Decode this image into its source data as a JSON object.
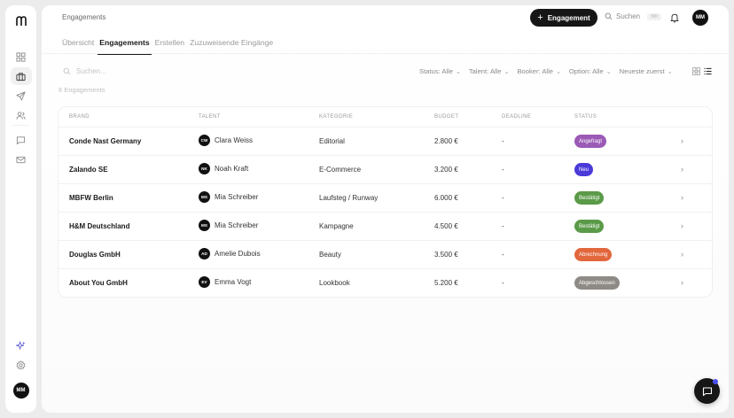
{
  "sidebar": {
    "logo": "logo-mark",
    "user_initials": "MM",
    "items": [
      {
        "icon": "grid-icon",
        "active": false
      },
      {
        "icon": "briefcase-icon",
        "active": true
      },
      {
        "icon": "send-icon",
        "active": false
      },
      {
        "icon": "users-icon",
        "active": false
      },
      {
        "icon": "chat-icon",
        "active": false
      },
      {
        "icon": "mail-icon",
        "active": false
      }
    ],
    "bottom_items": [
      {
        "icon": "sparkle-icon"
      },
      {
        "icon": "gear-icon"
      }
    ]
  },
  "header": {
    "breadcrumb": "Engagements",
    "new_button": "Engagement",
    "search_label": "Suchen",
    "search_shortcut": "⌘K",
    "user_initials": "MM"
  },
  "tabs": [
    {
      "label": "Übersicht",
      "active": false
    },
    {
      "label": "Engagements",
      "active": true
    },
    {
      "label": "Erstellen",
      "active": false
    },
    {
      "label": "Zuzuweisende Eingänge",
      "active": false
    }
  ],
  "toolbar": {
    "search_placeholder": "Suchen...",
    "filters": [
      {
        "label": "Status: Alle"
      },
      {
        "label": "Talent: Alle"
      },
      {
        "label": "Booker: Alle"
      },
      {
        "label": "Option: Alle"
      },
      {
        "label": "Neueste zuerst"
      }
    ],
    "view_modes": [
      "grid-view-icon",
      "list-view-icon"
    ],
    "active_view": "list"
  },
  "count_label": "6 Engagements",
  "table": {
    "columns": [
      "BRAND",
      "TALENT",
      "KATEGORIE",
      "BUDGET",
      "DEADLINE",
      "STATUS"
    ],
    "rows": [
      {
        "brand": "Conde Nast Germany",
        "initials": "CW",
        "talent": "Clara Weiss",
        "category": "Editorial",
        "budget": "2.800 €",
        "deadline": "-",
        "status": "Angefragt",
        "status_color": "#9b5ab5"
      },
      {
        "brand": "Zalando SE",
        "initials": "NK",
        "talent": "Noah Kraft",
        "category": "E-Commerce",
        "budget": "3.200 €",
        "deadline": "-",
        "status": "Neu",
        "status_color": "#4a3ad9"
      },
      {
        "brand": "MBFW Berlin",
        "initials": "MS",
        "talent": "Mia Schreiber",
        "category": "Laufsteg / Runway",
        "budget": "6.000 €",
        "deadline": "-",
        "status": "Bestätigt",
        "status_color": "#5a9a48"
      },
      {
        "brand": "H&M Deutschland",
        "initials": "MS",
        "talent": "Mia Schreiber",
        "category": "Kampagne",
        "budget": "4.500 €",
        "deadline": "-",
        "status": "Bestätigt",
        "status_color": "#5a9a48"
      },
      {
        "brand": "Douglas GmbH",
        "initials": "AD",
        "talent": "Amelie Dubois",
        "category": "Beauty",
        "budget": "3.500 €",
        "deadline": "-",
        "status": "Abrechnung",
        "status_color": "#e2673c"
      },
      {
        "brand": "About You GmbH",
        "initials": "EV",
        "talent": "Emma Vogt",
        "category": "Lookbook",
        "budget": "5.200 €",
        "deadline": "-",
        "status": "Abgeschlossen",
        "status_color": "#8e8a85"
      }
    ]
  },
  "chat_button": {
    "icon": "chat-bubble-icon",
    "has_notification": true
  }
}
